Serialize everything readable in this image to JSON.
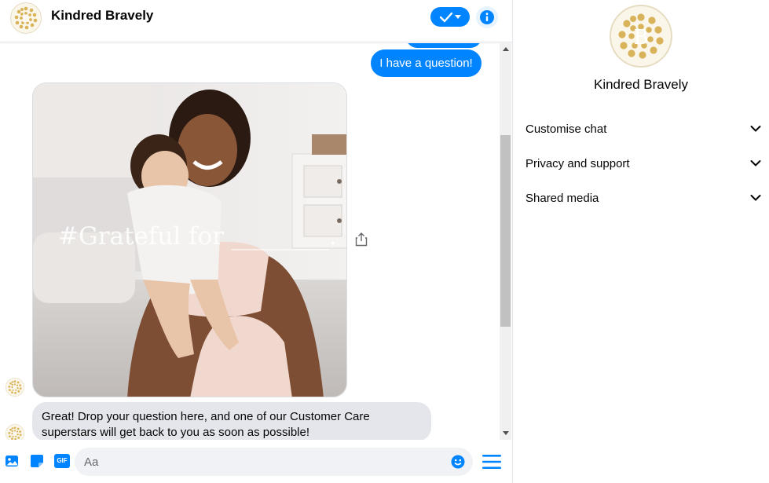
{
  "header": {
    "contact_name": "Kindred Bravely",
    "avatar_icon": "kindred-bravely-logo",
    "actions": [
      "checkmark-dropdown-icon",
      "info-icon"
    ]
  },
  "messages": {
    "outgoing": [
      {
        "text": "I have a question!"
      }
    ],
    "image_caption": "#Grateful for ________.",
    "incoming_text": "Great! Drop your question here, and one of our Customer Care superstars will get back to you as soon as possible!"
  },
  "composer": {
    "placeholder": "Aa",
    "icons": [
      "photo-icon",
      "sticker-icon",
      "gif-icon",
      "emoji-icon",
      "menu-icon"
    ],
    "gif_label": "GIF"
  },
  "side_panel": {
    "name": "Kindred Bravely",
    "sections": [
      {
        "label": "Customise chat"
      },
      {
        "label": "Privacy and support"
      },
      {
        "label": "Shared media"
      }
    ]
  },
  "colors": {
    "accent": "#0084ff",
    "incoming_bubble": "#e4e6eb",
    "logo_gold": "#d9b35a"
  }
}
